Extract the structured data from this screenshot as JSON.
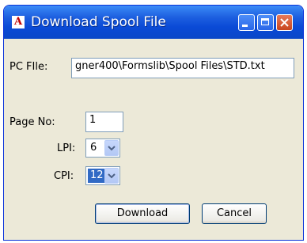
{
  "window": {
    "title": "Download Spool File",
    "app_icon_glyph": "A"
  },
  "form": {
    "pc_file_label": "PC FIle:",
    "pc_file_value": "gner400\\Formslib\\Spool Files\\STD.txt",
    "page_no_label": "Page No:",
    "page_no_value": "1",
    "lpi_label": "LPI:",
    "lpi_value": "6",
    "cpi_label": "CPI:",
    "cpi_value": "12"
  },
  "buttons": {
    "download_label": "Download",
    "cancel_label": "Cancel"
  },
  "colors": {
    "titlebar": "#0a4ad6",
    "dialog_bg": "#ece9d8",
    "selection": "#316ac5"
  }
}
